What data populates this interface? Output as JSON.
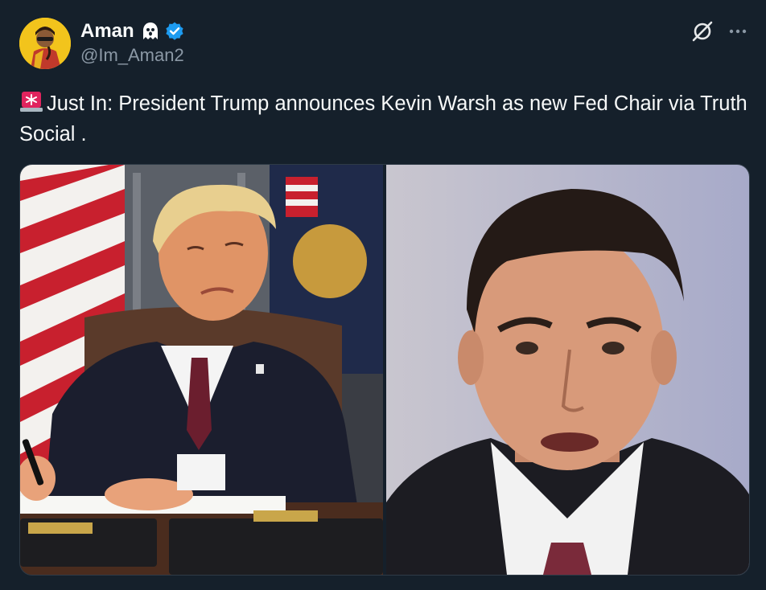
{
  "author": {
    "display_name": "Aman",
    "handle": "@Im_Aman2",
    "avatar_icon": "avatar-image",
    "badge_icons": [
      "ghost-icon",
      "verified-icon"
    ],
    "verified_color": "#1d9bf0"
  },
  "header_actions": {
    "grok_icon": "grok-icon",
    "more_icon": "more-icon"
  },
  "tweet": {
    "lead_icon": "siren-icon",
    "text": "Just In: President Trump announces Kevin Warsh as new Fed Chair via Truth Social ."
  },
  "media": {
    "count": 2,
    "items": [
      {
        "icon": "photo-president-trump"
      },
      {
        "icon": "photo-kevin-warsh"
      }
    ]
  },
  "colors": {
    "background": "#15202b",
    "text_primary": "#f7f9f9",
    "text_secondary": "#8b98a5",
    "accent": "#1d9bf0"
  }
}
